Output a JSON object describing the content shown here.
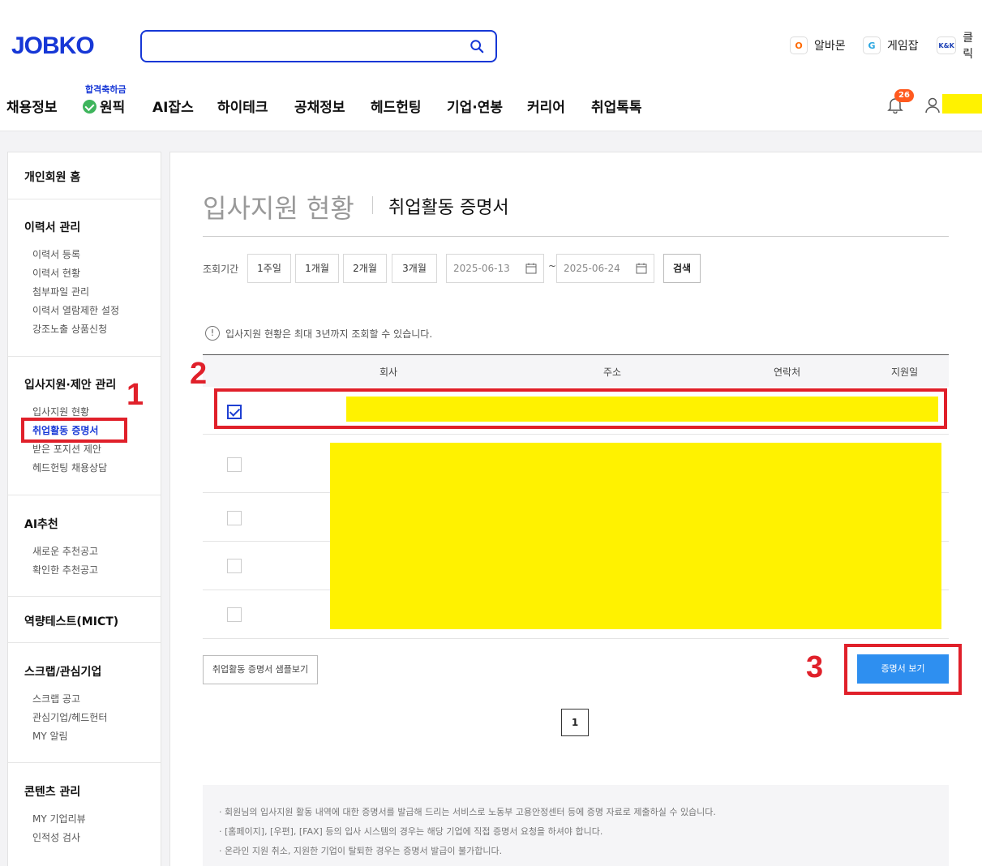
{
  "header": {
    "logo": "JOBKO",
    "search": {
      "value": "",
      "placeholder": ""
    },
    "family_links": [
      {
        "label": "알바몬",
        "badge": "O",
        "color": "#ff6a00"
      },
      {
        "label": "게임잡",
        "badge": "G",
        "color": "#2aa6e0"
      },
      {
        "label": "클릭",
        "badge": "K&K",
        "color": "#1a3fb5"
      }
    ],
    "gnb": {
      "items": [
        "채용정보",
        "원픽",
        "AI잡스",
        "하이테크",
        "공채정보",
        "헤드헌팅",
        "기업·연봉",
        "커리어",
        "취업톡톡"
      ],
      "wonpick_tag": "합격축하금"
    },
    "notification_count": "26"
  },
  "sidebar": {
    "home": "개인회원 홈",
    "sections": [
      {
        "title": "이력서 관리",
        "items": [
          "이력서 등록",
          "이력서 현황",
          "첨부파일 관리",
          "이력서 열람제한 설정",
          "강조노출 상품신청"
        ]
      },
      {
        "title": "입사지원·제안 관리",
        "items": [
          "입사지원 현황",
          "취업활동 증명서",
          "받은 포지션 제안",
          "헤드헌팅 채용상담"
        ]
      },
      {
        "title": "AI추천",
        "items": [
          "새로운 추천공고",
          "확인한 추천공고"
        ]
      },
      {
        "title": "역량테스트(MICT)",
        "items": []
      },
      {
        "title": "스크랩/관심기업",
        "items": [
          "스크랩 공고",
          "관심기업/헤드헌터",
          "MY 알림"
        ]
      },
      {
        "title": "콘텐츠 관리",
        "items": [
          "MY 기업리뷰",
          "인적성 검사"
        ]
      }
    ],
    "active_item": "취업활동 증명서"
  },
  "main": {
    "title": "입사지원 현황",
    "subtitle": "취업활동 증명서",
    "filter": {
      "label": "조회기간",
      "periods": [
        "1주일",
        "1개월",
        "2개월",
        "3개월"
      ],
      "start_date": "2025-06-13",
      "end_date": "2025-06-24",
      "tilde": "~",
      "search_label": "검색"
    },
    "notice": "입사지원 현황은 최대 3년까지 조회할 수 있습니다.",
    "table": {
      "columns": [
        "회사",
        "주소",
        "연락처",
        "지원일"
      ],
      "rows": [
        {
          "checked": true
        },
        {
          "checked": false
        },
        {
          "checked": false
        },
        {
          "checked": false
        },
        {
          "checked": false
        }
      ]
    },
    "sample_button": "취업활동 증명서 샘플보기",
    "cert_button": "증명서 보기",
    "page": "1",
    "guide": [
      "회원님의 입사지원 활동 내역에 대한 증명서를 발급해 드리는 서비스로 노동부 고용안정센터 등에 증명 자료로 제출하실 수 있습니다.",
      "[홈페이지], [우편], [FAX] 등의 입사 시스템의 경우는 해당 기업에 직접 증명서 요청을 하셔야 합니다.",
      "온라인 지원 취소, 지원한 기업이 탈퇴한 경우는 증명서 발급이 불가합니다."
    ]
  },
  "annotations": [
    "1",
    "2",
    "3"
  ],
  "colors": {
    "brand": "#1637d6",
    "annotation": "#e0202a",
    "redaction": "#fff200",
    "primary_button": "#2e8ff0"
  }
}
